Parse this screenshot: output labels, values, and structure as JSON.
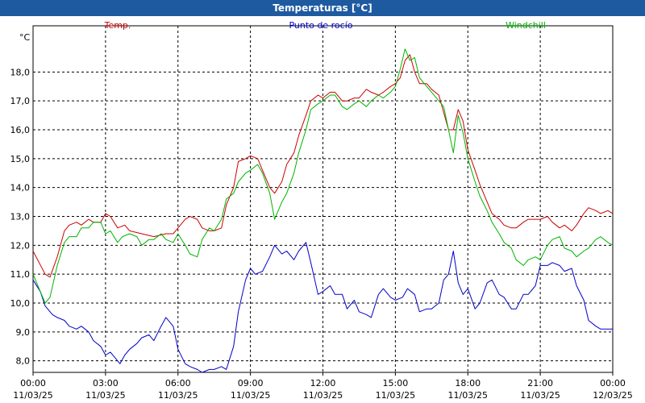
{
  "window": {
    "title": "Temperaturas [°C]"
  },
  "chart_data": {
    "type": "line",
    "title": "Temperaturas [°C]",
    "ylabel": "°C",
    "ylim": [
      7.6,
      19.6
    ],
    "yticks": [
      "8,0",
      "9,0",
      "10,0",
      "11,0",
      "12,0",
      "13,0",
      "14,0",
      "15,0",
      "16,0",
      "17,0",
      "18,0"
    ],
    "xlim": [
      0,
      24
    ],
    "xticks": [
      {
        "time": "00:00",
        "date": "11/03/25"
      },
      {
        "time": "03:00",
        "date": "11/03/25"
      },
      {
        "time": "06:00",
        "date": "11/03/25"
      },
      {
        "time": "09:00",
        "date": "11/03/25"
      },
      {
        "time": "12:00",
        "date": "11/03/25"
      },
      {
        "time": "15:00",
        "date": "11/03/25"
      },
      {
        "time": "18:00",
        "date": "11/03/25"
      },
      {
        "time": "21:00",
        "date": "11/03/25"
      },
      {
        "time": "00:00",
        "date": "12/03/25"
      }
    ],
    "grid": true,
    "legend_position": "top",
    "series": [
      {
        "name": "Temp.",
        "color": "#cc0000",
        "x": [
          0,
          0.5,
          0.7,
          1.0,
          1.3,
          1.5,
          1.8,
          2.0,
          2.3,
          2.5,
          2.8,
          3.0,
          3.2,
          3.5,
          3.8,
          4.0,
          4.5,
          5.0,
          5.5,
          5.8,
          6.0,
          6.3,
          6.5,
          6.8,
          7.0,
          7.3,
          7.5,
          7.8,
          8.0,
          8.3,
          8.5,
          8.8,
          9.0,
          9.3,
          9.5,
          9.8,
          10.0,
          10.3,
          10.5,
          10.8,
          11.0,
          11.3,
          11.5,
          11.8,
          12.0,
          12.3,
          12.5,
          12.8,
          13.0,
          13.3,
          13.5,
          13.8,
          14.0,
          14.3,
          14.5,
          14.8,
          15.0,
          15.2,
          15.4,
          15.6,
          15.8,
          16.0,
          16.3,
          16.5,
          16.8,
          17.0,
          17.2,
          17.4,
          17.6,
          17.8,
          18.0,
          18.3,
          18.5,
          18.8,
          19.0,
          19.3,
          19.5,
          19.8,
          20.0,
          20.3,
          20.5,
          20.8,
          21.0,
          21.3,
          21.5,
          21.8,
          22.0,
          22.3,
          22.5,
          22.8,
          23.0,
          23.3,
          23.5,
          23.8,
          24.0
        ],
        "values": [
          11.8,
          11.0,
          10.9,
          11.6,
          12.5,
          12.7,
          12.8,
          12.7,
          12.9,
          12.8,
          12.8,
          13.1,
          13.0,
          12.6,
          12.7,
          12.5,
          12.4,
          12.3,
          12.4,
          12.4,
          12.6,
          12.9,
          13.0,
          12.9,
          12.6,
          12.5,
          12.5,
          12.6,
          13.4,
          14.0,
          14.9,
          15.0,
          15.1,
          15.0,
          14.6,
          14.0,
          13.8,
          14.2,
          14.8,
          15.2,
          15.8,
          16.5,
          17.0,
          17.2,
          17.1,
          17.3,
          17.3,
          17.0,
          17.0,
          17.1,
          17.1,
          17.4,
          17.3,
          17.2,
          17.3,
          17.5,
          17.6,
          17.8,
          18.4,
          18.6,
          18.0,
          17.6,
          17.6,
          17.4,
          17.2,
          16.6,
          16.0,
          16.0,
          16.7,
          16.3,
          15.3,
          14.6,
          14.1,
          13.5,
          13.1,
          12.9,
          12.7,
          12.6,
          12.6,
          12.8,
          12.9,
          12.9,
          12.9,
          13.0,
          12.8,
          12.6,
          12.7,
          12.5,
          12.7,
          13.1,
          13.3,
          13.2,
          13.1,
          13.2,
          13.1
        ]
      },
      {
        "name": "Punto de rocío",
        "color": "#0000c8",
        "x": [
          0,
          0.3,
          0.5,
          0.8,
          1.0,
          1.3,
          1.5,
          1.8,
          2.0,
          2.3,
          2.5,
          2.8,
          3.0,
          3.2,
          3.4,
          3.6,
          3.8,
          4.0,
          4.3,
          4.5,
          4.8,
          5.0,
          5.3,
          5.5,
          5.8,
          6.0,
          6.3,
          6.5,
          6.8,
          7.0,
          7.3,
          7.5,
          7.8,
          8.0,
          8.3,
          8.5,
          8.8,
          9.0,
          9.2,
          9.5,
          9.8,
          10.0,
          10.3,
          10.5,
          10.8,
          11.0,
          11.3,
          11.5,
          11.8,
          12.0,
          12.3,
          12.5,
          12.8,
          13.0,
          13.3,
          13.5,
          13.8,
          14.0,
          14.3,
          14.5,
          14.8,
          15.0,
          15.3,
          15.5,
          15.8,
          16.0,
          16.3,
          16.5,
          16.8,
          17.0,
          17.2,
          17.4,
          17.6,
          17.8,
          18.0,
          18.3,
          18.5,
          18.8,
          19.0,
          19.3,
          19.5,
          19.8,
          20.0,
          20.3,
          20.5,
          20.8,
          21.0,
          21.3,
          21.5,
          21.8,
          22.0,
          22.3,
          22.5,
          22.8,
          23.0,
          23.3,
          23.5,
          23.8,
          24.0
        ],
        "values": [
          10.8,
          10.4,
          9.9,
          9.6,
          9.5,
          9.4,
          9.2,
          9.1,
          9.2,
          9.0,
          8.7,
          8.5,
          8.2,
          8.3,
          8.1,
          7.9,
          8.2,
          8.4,
          8.6,
          8.8,
          8.9,
          8.7,
          9.2,
          9.5,
          9.2,
          8.4,
          7.9,
          7.8,
          7.7,
          7.6,
          7.7,
          7.7,
          7.8,
          7.7,
          8.5,
          9.7,
          10.8,
          11.2,
          11.0,
          11.1,
          11.6,
          12.0,
          11.7,
          11.8,
          11.5,
          11.8,
          12.1,
          11.4,
          10.3,
          10.4,
          10.6,
          10.3,
          10.3,
          9.8,
          10.1,
          9.7,
          9.6,
          9.5,
          10.3,
          10.5,
          10.2,
          10.1,
          10.2,
          10.5,
          10.3,
          9.7,
          9.8,
          9.8,
          10.0,
          10.8,
          11.0,
          11.8,
          10.7,
          10.3,
          10.5,
          9.8,
          10.0,
          10.7,
          10.8,
          10.3,
          10.2,
          9.8,
          9.8,
          10.3,
          10.3,
          10.6,
          11.3,
          11.3,
          11.4,
          11.3,
          11.1,
          11.2,
          10.6,
          10.1,
          9.4,
          9.2,
          9.1,
          9.1,
          9.1
        ]
      },
      {
        "name": "Windchill",
        "color": "#00b400",
        "x": [
          0,
          0.3,
          0.5,
          0.7,
          1.0,
          1.3,
          1.5,
          1.8,
          2.0,
          2.3,
          2.5,
          2.8,
          3.0,
          3.2,
          3.5,
          3.7,
          4.0,
          4.3,
          4.5,
          4.8,
          5.0,
          5.3,
          5.5,
          5.8,
          6.0,
          6.3,
          6.5,
          6.8,
          7.0,
          7.3,
          7.5,
          7.8,
          8.0,
          8.3,
          8.5,
          8.8,
          9.0,
          9.3,
          9.5,
          9.8,
          10.0,
          10.3,
          10.5,
          10.8,
          11.0,
          11.3,
          11.5,
          11.8,
          12.0,
          12.3,
          12.5,
          12.8,
          13.0,
          13.3,
          13.5,
          13.8,
          14.0,
          14.3,
          14.5,
          14.8,
          15.0,
          15.2,
          15.4,
          15.6,
          15.8,
          16.0,
          16.3,
          16.5,
          16.8,
          17.0,
          17.2,
          17.4,
          17.6,
          17.8,
          18.0,
          18.3,
          18.5,
          18.8,
          19.0,
          19.3,
          19.5,
          19.8,
          20.0,
          20.3,
          20.5,
          20.8,
          21.0,
          21.3,
          21.5,
          21.8,
          22.0,
          22.3,
          22.5,
          22.8,
          23.0,
          23.3,
          23.5,
          23.8,
          24.0
        ],
        "values": [
          11.0,
          10.4,
          10.0,
          10.2,
          11.3,
          12.1,
          12.3,
          12.3,
          12.6,
          12.6,
          12.8,
          12.8,
          12.4,
          12.5,
          12.1,
          12.3,
          12.4,
          12.3,
          12.0,
          12.2,
          12.2,
          12.4,
          12.2,
          12.1,
          12.4,
          12.0,
          11.7,
          11.6,
          12.2,
          12.6,
          12.5,
          12.9,
          13.6,
          13.8,
          14.2,
          14.5,
          14.6,
          14.8,
          14.5,
          13.8,
          12.9,
          13.5,
          13.8,
          14.5,
          15.2,
          16.0,
          16.7,
          16.9,
          17.0,
          17.2,
          17.2,
          16.8,
          16.7,
          16.9,
          17.0,
          16.8,
          17.0,
          17.2,
          17.1,
          17.3,
          17.5,
          18.1,
          18.8,
          18.4,
          18.5,
          17.8,
          17.5,
          17.3,
          17.0,
          16.8,
          16.0,
          15.2,
          16.5,
          15.9,
          15.0,
          14.2,
          13.7,
          13.2,
          12.8,
          12.4,
          12.1,
          11.9,
          11.5,
          11.3,
          11.5,
          11.6,
          11.5,
          12.0,
          12.2,
          12.3,
          11.9,
          11.8,
          11.6,
          11.8,
          11.9,
          12.2,
          12.3,
          12.1,
          12.0
        ]
      }
    ]
  }
}
